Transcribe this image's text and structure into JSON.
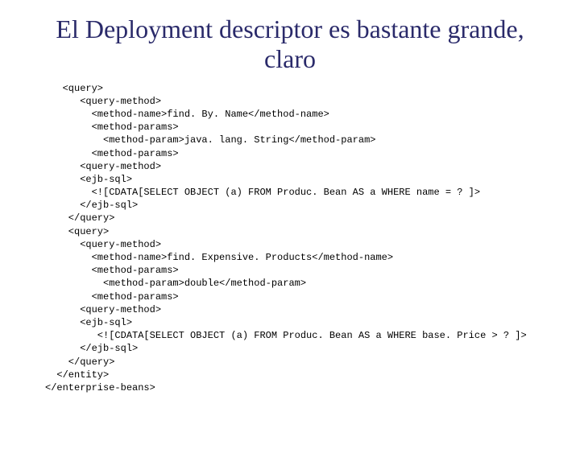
{
  "title": "El Deployment descriptor es bastante grande, claro",
  "code": "   <query>\n      <query-method>\n        <method-name>find. By. Name</method-name>\n        <method-params>\n          <method-param>java. lang. String</method-param>\n        <method-params>\n      <query-method>\n      <ejb-sql>\n        <![CDATA[SELECT OBJECT (a) FROM Produc. Bean AS a WHERE name = ? ]>\n      </ejb-sql>\n    </query>\n    <query>\n      <query-method>\n        <method-name>find. Expensive. Products</method-name>\n        <method-params>\n          <method-param>double</method-param>\n        <method-params>\n      <query-method>\n      <ejb-sql>\n         <![CDATA[SELECT OBJECT (a) FROM Produc. Bean AS a WHERE base. Price > ? ]>\n      </ejb-sql>\n    </query>\n  </entity>\n</enterprise-beans>"
}
